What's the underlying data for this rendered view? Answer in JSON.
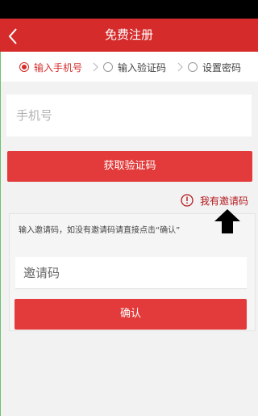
{
  "app_bar": {
    "title": "免费注册",
    "back_icon": "chevron-left-icon"
  },
  "steps": [
    {
      "label": "输入手机号",
      "active": true
    },
    {
      "label": "输入验证码",
      "active": false
    },
    {
      "label": "设置密码",
      "active": false
    }
  ],
  "phone": {
    "placeholder": "手机号",
    "value": ""
  },
  "get_code_button": {
    "label": "获取验证码"
  },
  "invite_toggle": {
    "label": "我有邀请码",
    "icon": "info-icon"
  },
  "invite_panel": {
    "hint": "输入邀请码，如没有邀请码请直接点击“确认”",
    "input_placeholder": "邀请码",
    "input_value": "",
    "confirm_label": "确认"
  },
  "overlay": {
    "icon": "arrow-up-icon"
  },
  "colors": {
    "brand_red": "#d52b2b",
    "button_red": "#e33b3b",
    "link_red": "#b4181d",
    "background": "#f2f2f2"
  }
}
